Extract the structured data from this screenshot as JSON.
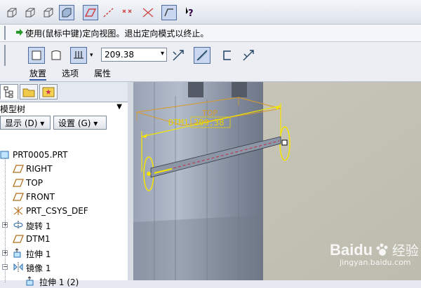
{
  "message": {
    "text": "使用(鼠标中键)定向视图。退出定向模式以终止。"
  },
  "dashboard": {
    "offset_value": "209.38",
    "tabs": [
      "放置",
      "选项",
      "属性"
    ]
  },
  "model_tree": {
    "title": "模型树",
    "show_button": "显示 (D) ▾",
    "settings_button": "设置 (G) ▾",
    "items": [
      {
        "label": "PRT0005.PRT",
        "icon": "part-icon"
      },
      {
        "label": "RIGHT",
        "icon": "datum-plane-icon"
      },
      {
        "label": "TOP",
        "icon": "datum-plane-icon"
      },
      {
        "label": "FRONT",
        "icon": "datum-plane-icon"
      },
      {
        "label": "PRT_CSYS_DEF",
        "icon": "coordinate-system-icon"
      },
      {
        "label": "旋转 1",
        "icon": "revolve-icon"
      },
      {
        "label": "DTM1",
        "icon": "datum-plane-icon"
      },
      {
        "label": "拉伸 1",
        "icon": "extrude-icon"
      },
      {
        "label": "镜像 1",
        "icon": "mirror-icon"
      },
      {
        "label": "拉伸 1 (2)",
        "icon": "extrude-icon"
      }
    ]
  },
  "viewport": {
    "plane_label": "DTM1",
    "top_label": "TOP",
    "dimension": "209.38"
  },
  "watermark": {
    "brand": "Baidu",
    "site_cn": "经验",
    "url": "jingyan.baidu.com"
  },
  "colors": {
    "accent": "#2e5aa8",
    "highlight": "#ffff00",
    "datum": "#d99a2b",
    "model": "#8f99aa"
  }
}
